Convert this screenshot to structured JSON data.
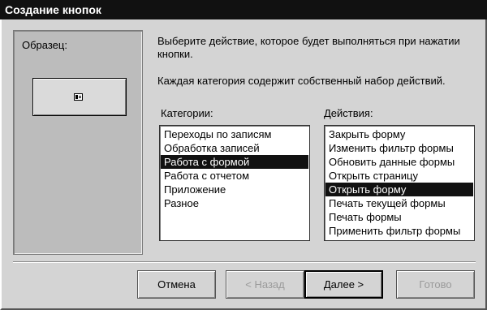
{
  "window": {
    "title": "Создание кнопок"
  },
  "sample": {
    "label": "Образец:"
  },
  "description": {
    "line1": "Выберите действие, которое будет выполняться при нажатии кнопки.",
    "line2": "Каждая категория содержит собственный набор действий."
  },
  "categories": {
    "label": "Категории:",
    "items": [
      "Переходы по записям",
      "Обработка записей",
      "Работа с формой",
      "Работа с отчетом",
      "Приложение",
      "Разное"
    ],
    "selected": "Работа с формой"
  },
  "actions": {
    "label": "Действия:",
    "items": [
      "Закрыть форму",
      "Изменить фильтр формы",
      "Обновить данные формы",
      "Открыть страницу",
      "Открыть форму",
      "Печать текущей формы",
      "Печать формы",
      "Применить фильтр формы"
    ],
    "selected": "Открыть форму"
  },
  "buttons": {
    "cancel": "Отмена",
    "back": "< Назад",
    "next": "Далее >",
    "finish": "Готово"
  },
  "colors": {
    "titlebar": "#111111",
    "selection": "#111111",
    "dialog_bg": "#d4d4d4"
  }
}
